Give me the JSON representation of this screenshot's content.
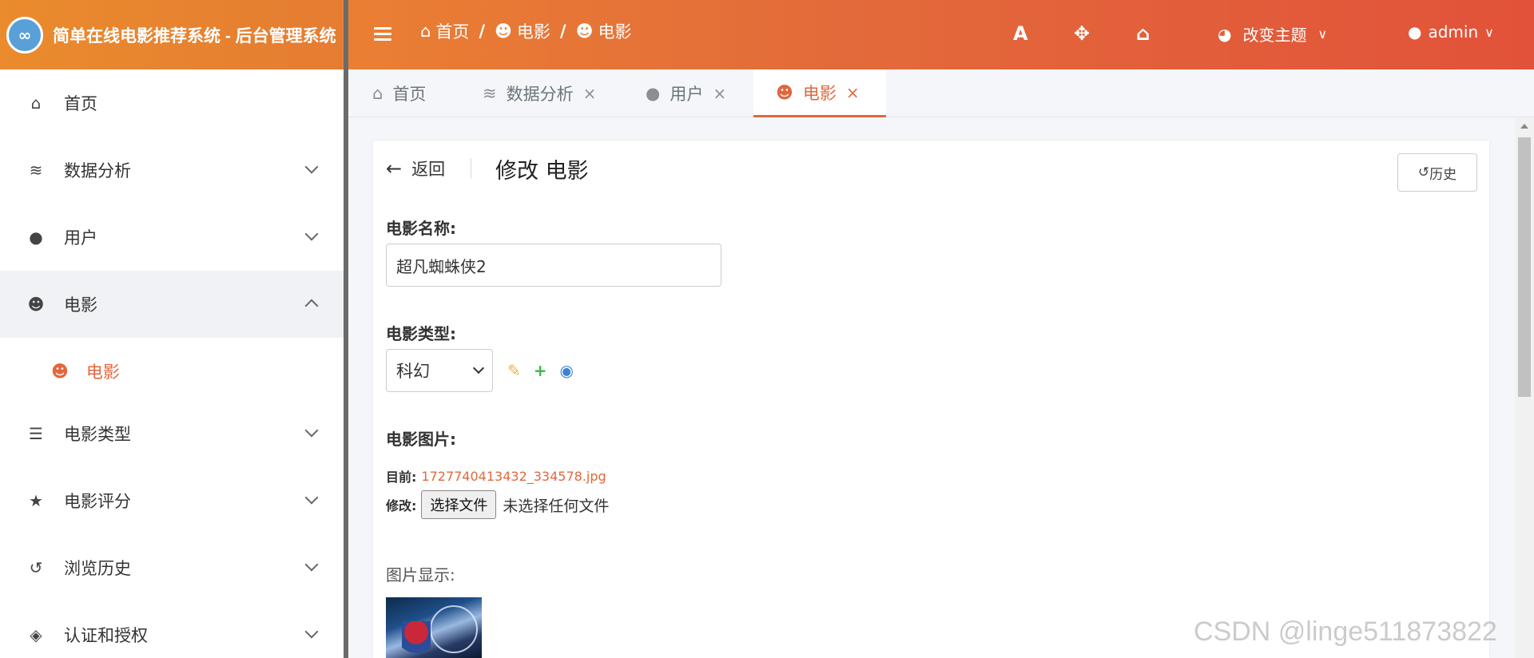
{
  "header": {
    "brand_title": "简单在线电影推荐系统 - 后台管理系统",
    "breadcrumb": [
      "首页",
      "电影",
      "电影"
    ],
    "breadcrumb_sep": "/",
    "theme_label": "改变主题",
    "user_label": "admin",
    "icons": [
      "font-icon",
      "expand-icon",
      "home-icon",
      "palette-icon",
      "user-icon"
    ]
  },
  "sidebar": {
    "items": [
      {
        "label": "首页",
        "icon": "home-icon"
      },
      {
        "label": "数据分析",
        "icon": "database-icon"
      },
      {
        "label": "用户",
        "icon": "user-icon"
      },
      {
        "label": "电影",
        "icon": "github-icon",
        "active": true
      },
      {
        "label": "电影",
        "icon": "github-icon",
        "sub": true
      },
      {
        "label": "电影类型",
        "icon": "list-icon"
      },
      {
        "label": "电影评分",
        "icon": "star-icon"
      },
      {
        "label": "浏览历史",
        "icon": "history-icon"
      },
      {
        "label": "认证和授权",
        "icon": "shield-icon"
      }
    ]
  },
  "tabs": [
    {
      "label": "首页",
      "closable": false
    },
    {
      "label": "数据分析",
      "closable": true
    },
    {
      "label": "用户",
      "closable": true
    },
    {
      "label": "电影",
      "closable": true,
      "active": true
    }
  ],
  "tab_close": "×",
  "form": {
    "back_label": "返回",
    "title": "修改 电影",
    "history_label": "历史",
    "name_label": "电影名称:",
    "name_value": "超凡蜘蛛侠2",
    "type_label": "电影类型:",
    "type_value": "科幻",
    "image_label": "电影图片:",
    "current_label": "目前:",
    "current_file": "1727740413432_334578.jpg",
    "change_label": "修改:",
    "choose_file": "选择文件",
    "no_file": "未选择任何文件",
    "preview_label": "图片显示:"
  },
  "watermark": "CSDN @linge511873822",
  "colors": {
    "accent": "#e2673c",
    "header_start": "#ef8e2e",
    "header_end": "#e2523a"
  }
}
